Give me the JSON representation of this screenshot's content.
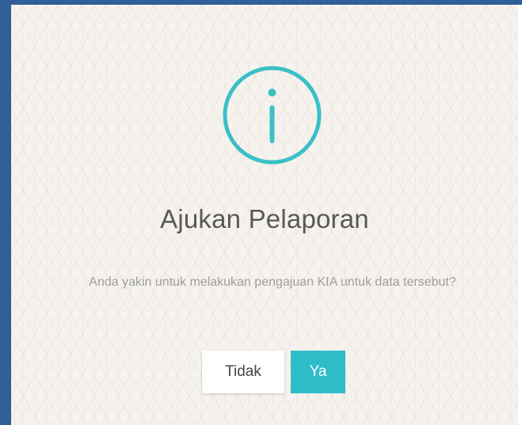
{
  "dialog": {
    "icon": "info-icon",
    "title": "Ajukan Pelaporan",
    "message": "Anda yakin untuk melakukan pengajuan KIA untuk data tersebut?",
    "buttons": {
      "no_label": "Tidak",
      "yes_label": "Ya"
    }
  },
  "colors": {
    "accent": "#2ebdc8",
    "icon": "#3cbfc7",
    "title_text": "#585858",
    "message_text": "#9e9e9e",
    "dialog_background": "#f6f3ef",
    "frame_border": "#2f5f96"
  }
}
